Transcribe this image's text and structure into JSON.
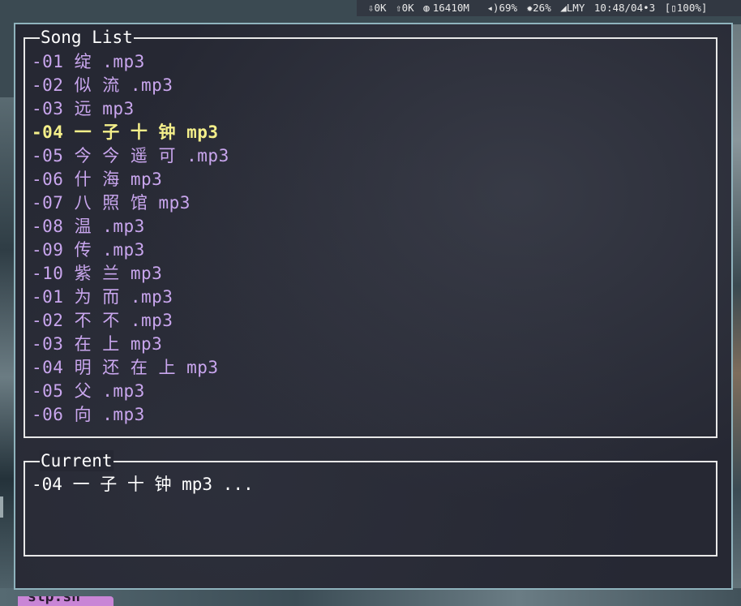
{
  "status_bar": {
    "net_down": "⇩0K",
    "net_up": "⇧0K",
    "memory": "16410M",
    "volume": "69%",
    "brightness": "26%",
    "location": "LMY",
    "time": "10:48/04",
    "date_suffix": "3",
    "battery": "100%]"
  },
  "song_list": {
    "title": "Song List",
    "songs": [
      "-01 绽 .mp3",
      "-02 似 流 .mp3",
      "-03 远 mp3",
      "-04 一 子 十 钟 mp3",
      "-05 今 今 遥 可 .mp3",
      "-06 什 海 mp3",
      "-07 八 照 馆 mp3",
      "-08 温 .mp3",
      "-09 传 .mp3",
      "-10 紫 兰 mp3",
      "-01 为 而 .mp3",
      "-02 不 不 .mp3",
      "-03 在 上 mp3",
      "-04 明 还 在 上 mp3",
      "-05 父 .mp3",
      "-06 向 .mp3"
    ],
    "active_index": 3
  },
  "current": {
    "title": "Current",
    "now_playing": "-04 一 子 十 钟 mp3 ..."
  },
  "taskbar": {
    "tab_label": "stp.sh"
  },
  "colors": {
    "song_color": "#c9a6ee",
    "active_color": "#f4ef8a",
    "border_color": "#e8e8e8",
    "window_border": "#8fb3bd"
  }
}
